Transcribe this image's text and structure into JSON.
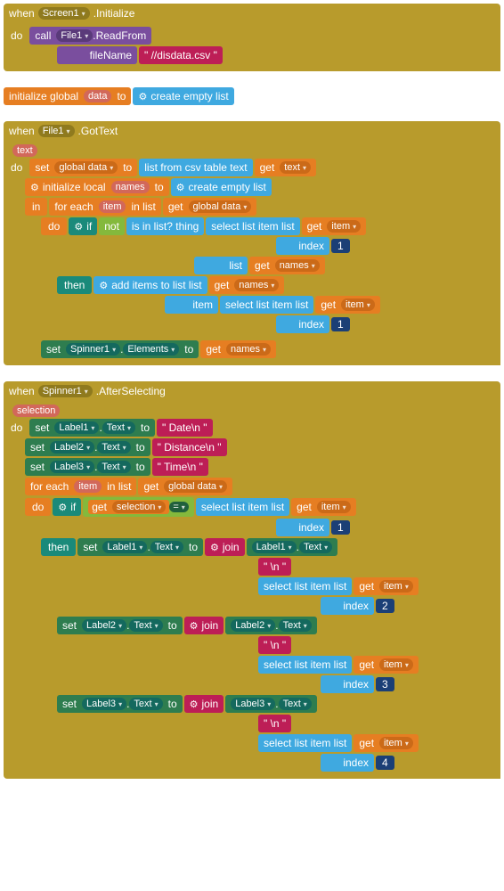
{
  "event1": {
    "when": "when",
    "screen": "Screen1",
    "init": ".Initialize",
    "do": "do",
    "call": "call",
    "file": "File1",
    "readfrom": ".ReadFrom",
    "filename_lbl": "fileName",
    "filename_val": "\" //disdata.csv \""
  },
  "globalInit": {
    "init": "initialize global",
    "data": "data",
    "to": "to",
    "gear": "",
    "create": "create empty list"
  },
  "event2": {
    "when": "when",
    "file": "File1",
    "got": ".GotText",
    "arg": "text",
    "do": "do",
    "set": "set",
    "global_data": "global data",
    "to": "to",
    "listcsv": "list from csv table  text",
    "get": "get",
    "text": "text",
    "initlocal": "initialize local",
    "names": "names",
    "create": "create empty list",
    "in": "in",
    "foreach": "for each",
    "item": "item",
    "inlist": "in list",
    "gdata": "global data",
    "do2": "do",
    "if": "if",
    "not": "not",
    "isinlist": "is in list? thing",
    "sel_list_item": "select list item  list",
    "index": "index",
    "one": "1",
    "list_lbl": "list",
    "then": "then",
    "additems": "add items to list   list",
    "item_lbl": "item",
    "set2": "set",
    "spinner": "Spinner1",
    "elements": "Elements",
    "names2": "names"
  },
  "event3": {
    "when": "when",
    "spinner": "Spinner1",
    "after": ".AfterSelecting",
    "arg": "selection",
    "do": "do",
    "set": "set",
    "label1": "Label1",
    "label2": "Label2",
    "label3": "Label3",
    "dot": ".",
    "text": "Text",
    "to": "to",
    "v_date": "\" Date\\n \"",
    "v_dist": "\" Distance\\n \"",
    "v_time": "\" Time\\n \"",
    "foreach": "for each",
    "item": "item",
    "inlist": "in list",
    "get": "get",
    "gdata": "global data",
    "do2": "do",
    "if": "if",
    "selection": "selection",
    "eq": "=",
    "sel_list_item": "select list item  list",
    "index": "index",
    "n1": "1",
    "n2": "2",
    "n3": "3",
    "n4": "4",
    "then": "then",
    "join": "join",
    "nl": "\" \\n \""
  }
}
